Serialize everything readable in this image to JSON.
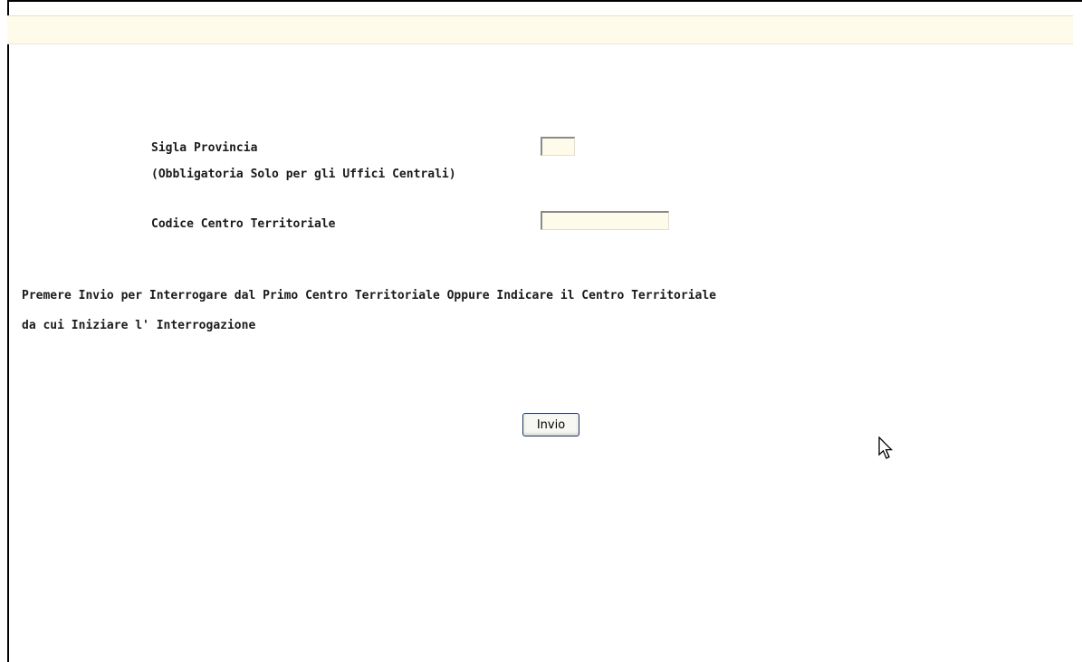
{
  "form": {
    "provincia_label": "Sigla Provincia",
    "provincia_note": "(Obbligatoria Solo per gli Uffici Centrali)",
    "provincia_value": "",
    "centro_label": "Codice Centro Territoriale",
    "centro_value": ""
  },
  "instructions": {
    "line1": "Premere Invio per Interrogare dal Primo Centro Territoriale Oppure Indicare il Centro Territoriale",
    "line2": "da cui Iniziare l' Interrogazione"
  },
  "actions": {
    "submit_label": "Invio"
  },
  "colors": {
    "field_background": "#fffbea",
    "button_border": "#1c3a6e"
  },
  "icons": {
    "pointer": "mouse-pointer-icon"
  }
}
